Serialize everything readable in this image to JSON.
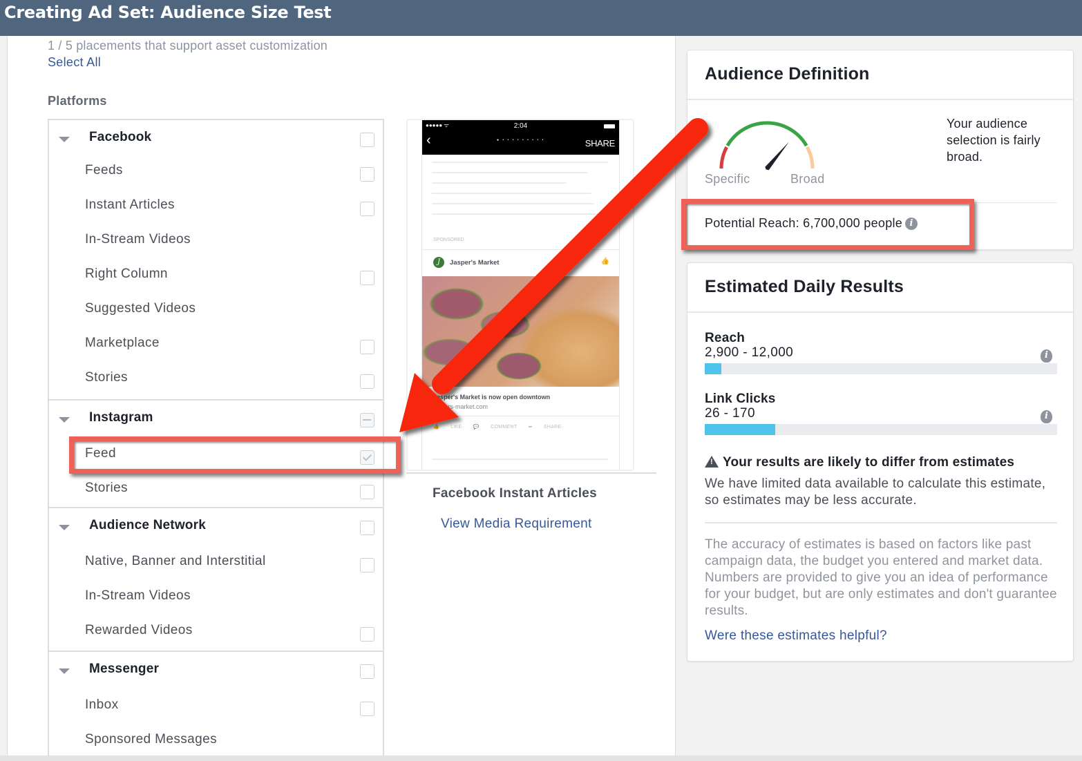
{
  "header": {
    "title": "Creating Ad Set: Audience Size Test"
  },
  "placements": {
    "summary": "1 / 5 placements that support asset customization",
    "select_all": "Select All",
    "platforms_label": "Platforms",
    "groups": [
      {
        "name": "Facebook",
        "state": "unchecked",
        "items": [
          {
            "label": "Feeds",
            "checkbox": "unchecked"
          },
          {
            "label": "Instant Articles",
            "checkbox": "unchecked"
          },
          {
            "label": "In-Stream Videos",
            "checkbox": "none"
          },
          {
            "label": "Right Column",
            "checkbox": "unchecked"
          },
          {
            "label": "Suggested Videos",
            "checkbox": "none"
          },
          {
            "label": "Marketplace",
            "checkbox": "unchecked"
          },
          {
            "label": "Stories",
            "checkbox": "unchecked"
          }
        ]
      },
      {
        "name": "Instagram",
        "state": "indeterminate",
        "items": [
          {
            "label": "Feed",
            "checkbox": "checked"
          },
          {
            "label": "Stories",
            "checkbox": "unchecked"
          }
        ]
      },
      {
        "name": "Audience Network",
        "state": "unchecked",
        "items": [
          {
            "label": "Native, Banner and Interstitial",
            "checkbox": "unchecked"
          },
          {
            "label": "In-Stream Videos",
            "checkbox": "none"
          },
          {
            "label": "Rewarded Videos",
            "checkbox": "unchecked"
          }
        ]
      },
      {
        "name": "Messenger",
        "state": "unchecked",
        "items": [
          {
            "label": "Inbox",
            "checkbox": "unchecked"
          },
          {
            "label": "Sponsored Messages",
            "checkbox": "none"
          }
        ]
      }
    ]
  },
  "preview": {
    "phone": {
      "time": "2:04",
      "signal": "●●●●● ᯤ",
      "back": "‹",
      "dots": "● • • • • • • • • •",
      "share": "SHARE",
      "sponsored": "SPONSORED",
      "page_initial": "J",
      "page_name": "Jasper's Market",
      "caption": "Jasper's Market is now open downtown",
      "url": "jaspers-market.com",
      "actions": "👍 LIKE 💬 COMMENT ➦ SHARE"
    },
    "placement_title": "Facebook Instant Articles",
    "media_link": "View Media Requirement"
  },
  "audience_definition": {
    "title": "Audience Definition",
    "gauge_min_label": "Specific",
    "gauge_max_label": "Broad",
    "gauge_value": 0.72,
    "description": "Your audience selection is fairly broad.",
    "potential_reach": "Potential Reach: 6,700,000 people",
    "info_icon": "i"
  },
  "estimated_daily_results": {
    "title": "Estimated Daily Results",
    "metrics": [
      {
        "label": "Reach",
        "value": "2,900 - 12,000",
        "fill": 0.047
      },
      {
        "label": "Link Clicks",
        "value": "26 - 170",
        "fill": 0.2
      }
    ],
    "warning_title": "Your results are likely to differ from estimates",
    "warning_body": "We have limited data available to calculate this estimate, so estimates may be less accurate.",
    "note": "The accuracy of estimates is based on factors like past campaign data, the budget you entered and market data. Numbers are provided to give you an idea of performance for your budget, but are only estimates and don't guarantee results.",
    "feedback_link": "Were these estimates helpful?"
  },
  "colors": {
    "header_bg": "#4f667e",
    "link": "#365899",
    "annotation_red": "#ee6157",
    "arrow_red": "#f7250b",
    "bar_fill": "#4fc3ea",
    "gauge_red": "#d33e3e",
    "gauge_green": "#3aa346",
    "gauge_orange": "#fdc997"
  }
}
